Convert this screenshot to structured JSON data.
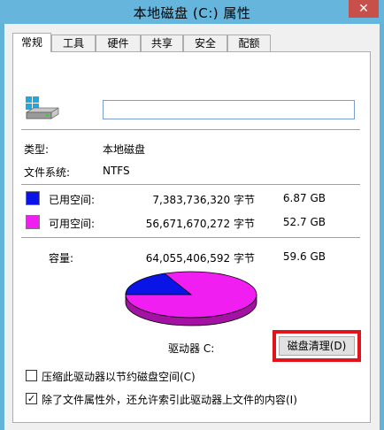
{
  "window": {
    "title": "本地磁盘 (C:) 属性",
    "close_glyph": "✕"
  },
  "tabs": [
    {
      "label": "常规"
    },
    {
      "label": "工具"
    },
    {
      "label": "硬件"
    },
    {
      "label": "共享"
    },
    {
      "label": "安全"
    },
    {
      "label": "配额"
    }
  ],
  "general": {
    "name_value": "",
    "type_label": "类型:",
    "type_value": "本地磁盘",
    "fs_label": "文件系统:",
    "fs_value": "NTFS",
    "used": {
      "label": "已用空间:",
      "bytes": "7,383,736,320 字节",
      "size": "6.87 GB",
      "color": "#0a14e6"
    },
    "free": {
      "label": "可用空间:",
      "bytes": "56,671,670,272 字节",
      "size": "52.7 GB",
      "color": "#f01ef0"
    },
    "capacity": {
      "label": "容量:",
      "bytes": "64,055,406,592 字节",
      "size": "59.6 GB"
    },
    "drive_label": "驱动器 C:",
    "cleanup_button": "磁盘清理(D)",
    "options": [
      {
        "label": "压缩此驱动器以节约磁盘空间(C)",
        "checked": false
      },
      {
        "label": "除了文件属性外，还允许索引此驱动器上文件的内容(I)",
        "checked": true
      }
    ]
  }
}
